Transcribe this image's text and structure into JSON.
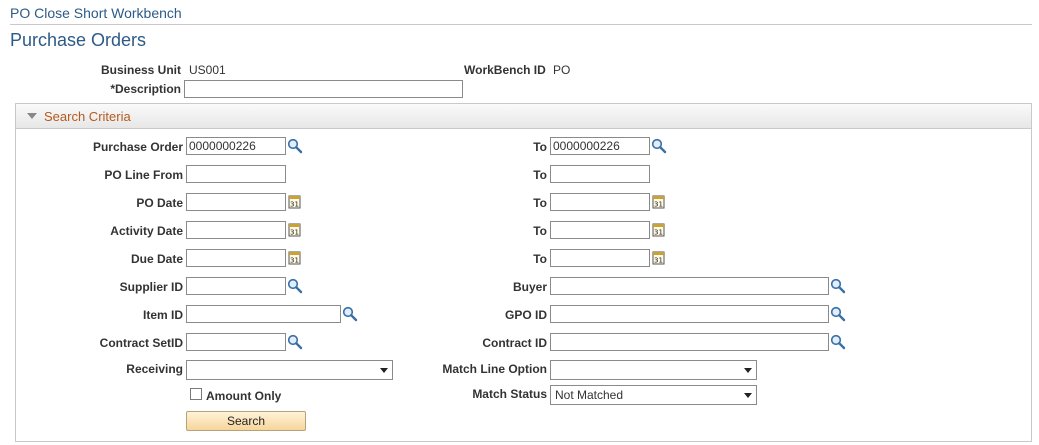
{
  "breadcrumb": "PO Close Short Workbench",
  "page_title": "Purchase Orders",
  "header": {
    "business_unit_label": "Business Unit",
    "business_unit_value": "US001",
    "workbench_label": "WorkBench ID",
    "workbench_value": "PO",
    "description_label": "*Description",
    "description_value": ""
  },
  "search_criteria": {
    "title": "Search Criteria",
    "purchase_order_label": "Purchase Order",
    "purchase_order_from": "0000000226",
    "purchase_order_to_label": "To",
    "purchase_order_to": "0000000226",
    "po_line_label": "PO Line From",
    "po_line_from": "",
    "po_line_to_label": "To",
    "po_line_to": "",
    "po_date_label": "PO Date",
    "po_date_from": "",
    "po_date_to_label": "To",
    "po_date_to": "",
    "activity_date_label": "Activity Date",
    "activity_date_from": "",
    "activity_date_to_label": "To",
    "activity_date_to": "",
    "due_date_label": "Due Date",
    "due_date_from": "",
    "due_date_to_label": "To",
    "due_date_to": "",
    "supplier_label": "Supplier ID",
    "supplier_value": "",
    "buyer_label": "Buyer",
    "buyer_value": "",
    "item_label": "Item ID",
    "item_value": "",
    "gpo_label": "GPO ID",
    "gpo_value": "",
    "contract_setid_label": "Contract SetID",
    "contract_setid_value": "",
    "contract_id_label": "Contract ID",
    "contract_id_value": "",
    "receiving_label": "Receiving",
    "receiving_value": "",
    "match_line_label": "Match Line Option",
    "match_line_value": "",
    "amount_only_label": "Amount Only",
    "amount_only_checked": false,
    "match_status_label": "Match Status",
    "match_status_value": "Not Matched",
    "search_button": "Search"
  },
  "icons": {
    "lookup": "magnifier-icon",
    "calendar": "calendar-icon",
    "calendar_glyph": "31"
  },
  "colors": {
    "title_blue": "#2d5a88",
    "group_title": "#b35a1f",
    "button_top": "#fff3d9",
    "button_bottom": "#f6d59b"
  }
}
